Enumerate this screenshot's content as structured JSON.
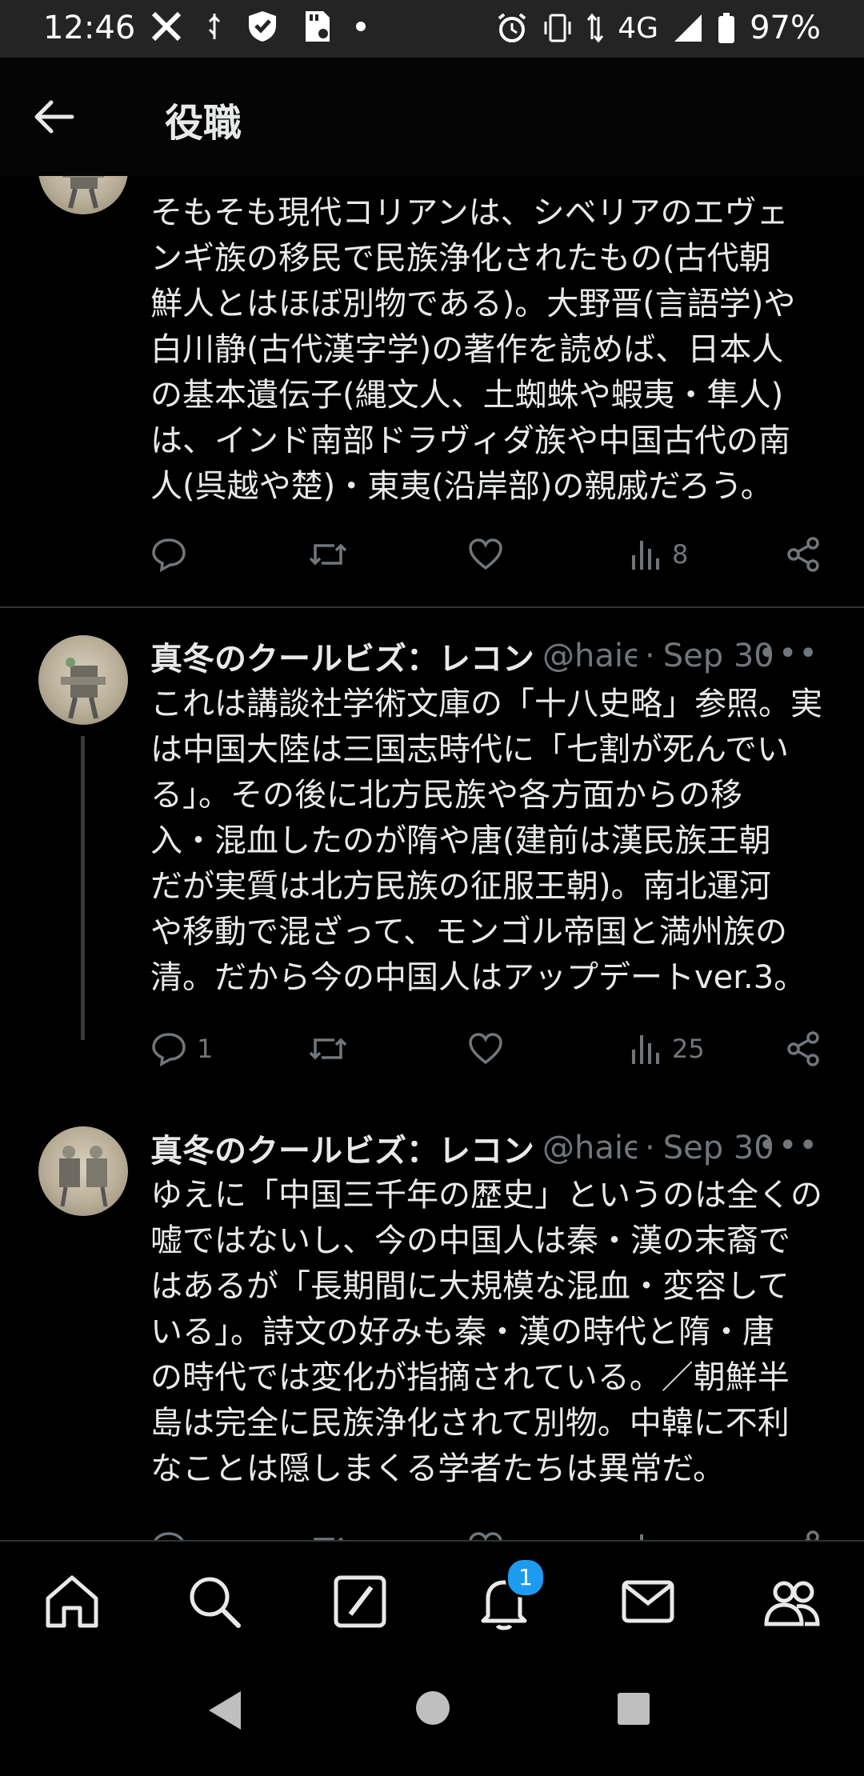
{
  "status_bar": {
    "time": "12:46",
    "left_icons": [
      "x-logo-icon",
      "usb-icon",
      "shield-icon",
      "sd-card-icon",
      "dot-icon"
    ],
    "network": "4G",
    "battery": "97%"
  },
  "header": {
    "title": "役職"
  },
  "tweets": [
    {
      "text": "そもそも現代コリアンは、シベリアのエヴェ\nンギ族の移民で民族浄化されたもの(古代朝\n鮮人とはほぼ別物である)。大野晋(言語学)や\n白川静(古代漢字学)の著作を読めば、日本人\nの基本遺伝子(縄文人、土蜘蛛や蝦夷・隼人)\nは、インド南部ドラヴィダ族や中国古代の南\n人(呉越や楚)・東夷(沿岸部)の親戚だろう。",
      "reply_count": "",
      "view_count": "8"
    },
    {
      "name": "真冬のクールビズ：レコン",
      "handle": "@haie",
      "date": "Sep 30",
      "text": "これは講談社学術文庫の「十八史略」参照。実\nは中国大陸は三国志時代に「七割が死んでい\nる」。その後に北方民族や各方面からの移\n入・混血したのが隋や唐(建前は漢民族王朝\nだが実質は北方民族の征服王朝)。南北運河\nや移動で混ざって、モンゴル帝国と満州族の\n清。だから今の中国人はアップデートver.3。",
      "reply_count": "1",
      "view_count": "25"
    },
    {
      "name": "真冬のクールビズ：レコン",
      "handle": "@haie",
      "date": "Sep 30",
      "text": "ゆえに「中国三千年の歴史」というのは全くの\n嘘ではないし、今の中国人は秦・漢の末裔で\nはあるが「長期間に大規模な混血・変容して\nいる」。詩文の好みも秦・漢の時代と隋・唐\nの時代では変化が指摘されている。／朝鮮半\n島は完全に民族浄化されて別物。中韓に不利\nなことは隠しまくる学者たちは異常だ。"
    }
  ],
  "separator": "·",
  "more_glyph": "•••",
  "bottom_nav": {
    "items": [
      "home-icon",
      "search-icon",
      "grok-icon",
      "notifications-icon",
      "messages-icon",
      "communities-icon"
    ],
    "notification_badge": "1"
  },
  "colors": {
    "accent": "#1d9bf0",
    "muted": "#71767b",
    "text": "#e7e9ea",
    "background": "#000000"
  }
}
